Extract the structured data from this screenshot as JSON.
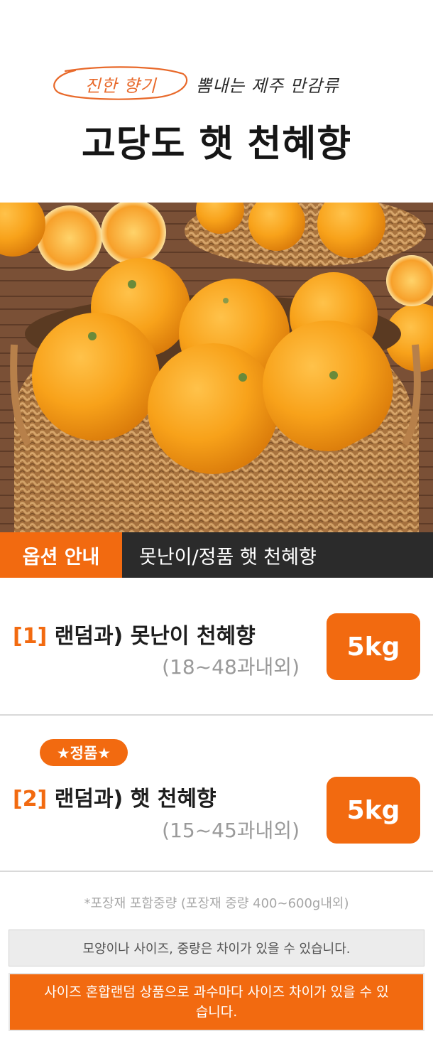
{
  "header": {
    "tag_highlight": "진한 향기",
    "tag_rest": "뽐내는 제주 만감류",
    "title": "고당도 햇 천혜향"
  },
  "photo": {
    "subject": "oranges-in-basket-image"
  },
  "option_bar": {
    "tag": "옵션 안내",
    "description": "못난이/정품 햇 천혜향"
  },
  "options": [
    {
      "number": "[1]",
      "name": "랜덤과) 못난이 천혜향",
      "count": "(18~48과내외)",
      "size": "5kg"
    },
    {
      "badge": "★정품★",
      "number": "[2]",
      "name": "랜덤과) 햇 천혜향",
      "count": "(15~45과내외)",
      "size": "5kg"
    }
  ],
  "notes": {
    "packaging": "*포장재 포함중량 (포장재 중량 400~600g내외)",
    "notice_gray": "모양이나 사이즈, 중량은 차이가 있을 수 있습니다.",
    "notice_orange": "사이즈 혼합랜덤 상품으로 과수마다 사이즈 차이가 있을 수 있습니다."
  },
  "colors": {
    "accent": "#f26a10",
    "dark_bar": "#2b2b2b",
    "muted_text": "#9a9a9a"
  }
}
